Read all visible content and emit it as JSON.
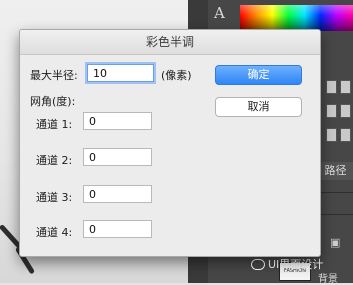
{
  "dialog": {
    "title": "彩色半调",
    "max_radius_label": "最大半径:",
    "max_radius_value": "10",
    "unit_label": "(像素)",
    "angle_group_label": "网角(度):",
    "channels": [
      {
        "label": "通道 1:",
        "value": "0"
      },
      {
        "label": "通道 2:",
        "value": "0"
      },
      {
        "label": "通道 3:",
        "value": "0"
      },
      {
        "label": "通道 4:",
        "value": "0"
      }
    ],
    "ok_label": "确定",
    "cancel_label": "取消"
  },
  "background": {
    "tool_label": "A",
    "panel_tab": "路径",
    "layer_name": "背景",
    "layer_thumb_text": "FASHION",
    "watermark": "UI界面设计"
  },
  "colors": {
    "accent": "#2f86f5",
    "focus_ring": "#9fc2f4",
    "dialog_bg": "#ececec",
    "panel_bg": "#474747"
  }
}
